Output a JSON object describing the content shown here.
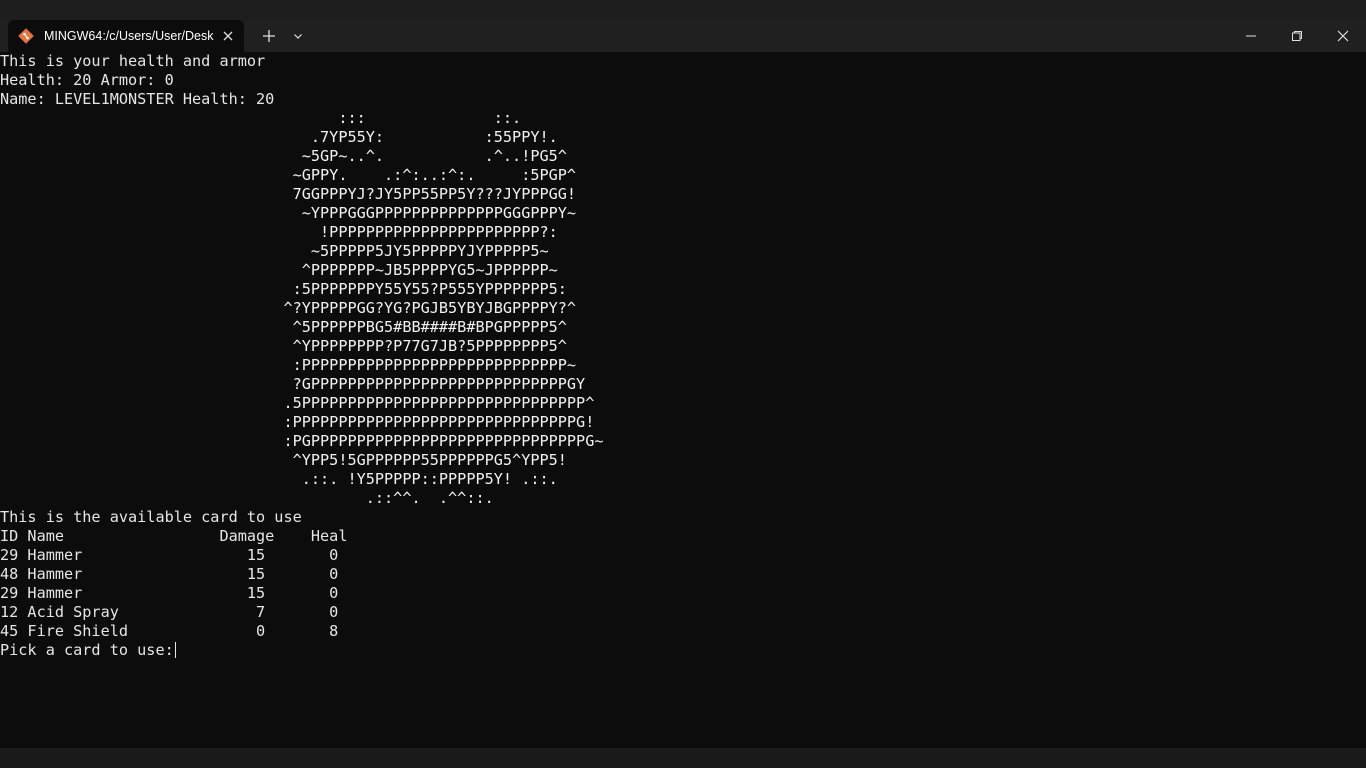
{
  "window": {
    "tab_title": "MINGW64:/c/Users/User/Desk",
    "icons": {
      "app": "git-diamond-icon",
      "tab_close": "close-icon",
      "new_tab": "plus-icon",
      "dropdown": "chevron-down-icon",
      "minimize": "minimize-icon",
      "restore": "restore-icon",
      "close": "close-icon"
    },
    "colors": {
      "background": "#0c0c0c",
      "titlebar": "#202020",
      "text": "#e6e6e6",
      "git_icon": "#e8723f"
    }
  },
  "terminal": {
    "status": {
      "intro": "This is your health and armor",
      "player": "Health: 20 Armor: 0",
      "monster": "Name: LEVEL1MONSTER Health: 20"
    },
    "art": [
      "                                     :::              ::.",
      "                                  .7YP55Y:           :55PPY!.",
      "                                 ~5GP~..^.           .^..!PG5^",
      "                                ~GPPY.    .:^:..:^:.     :5PGP^",
      "                                7GGPPPYJ?JY5PP55PP5Y???JYPPPGG!",
      "                                 ~YPPPGGGPPPPPPPPPPPPPPGGGPPPY~",
      "                                   !PPPPPPPPPPPPPPPPPPPPPPP?:",
      "                                  ~5PPPPP5JY5PPPPPYJYPPPPP5~",
      "                                 ^PPPPPPP~JB5PPPPYG5~JPPPPPP~",
      "                                :5PPPPPPPY55Y55?P555YPPPPPPP5:",
      "                               ^?YPPPPPGG?YG?PGJB5YBYJBGPPPPY?^",
      "                                ^5PPPPPPBG5#BB####B#BPGPPPPP5^",
      "                                ^YPPPPPPPP?P77G7JB?5PPPPPPPP5^",
      "                                :PPPPPPPPPPPPPPPPPPPPPPPPPPPPP~",
      "                                ?GPPPPPPPPPPPPPPPPPPPPPPPPPPPPGY",
      "                               .5PPPPPPPPPPPPPPPPPPPPPPPPPPPPPPP^",
      "                               :PPPPPPPPPPPPPPPPPPPPPPPPPPPPPPPG!",
      "                               :PGPPPPPPPPPPPPPPPPPPPPPPPPPPPPPPG~",
      "                                ^YPP5!5GPPPPPP55PPPPPPG5^YPP5!",
      "                                 .::. !Y5PPPPP::PPPPP5Y! .::.",
      "                                        .::^^.  .^^::."
    ],
    "cards": {
      "intro": "This is the available card to use",
      "header": "ID Name                 Damage    Heal",
      "rows": [
        "29 Hammer                  15       0",
        "48 Hammer                  15       0",
        "29 Hammer                  15       0",
        "12 Acid Spray               7       0",
        "45 Fire Shield              0       8"
      ]
    },
    "prompt": "Pick a card to use:"
  }
}
